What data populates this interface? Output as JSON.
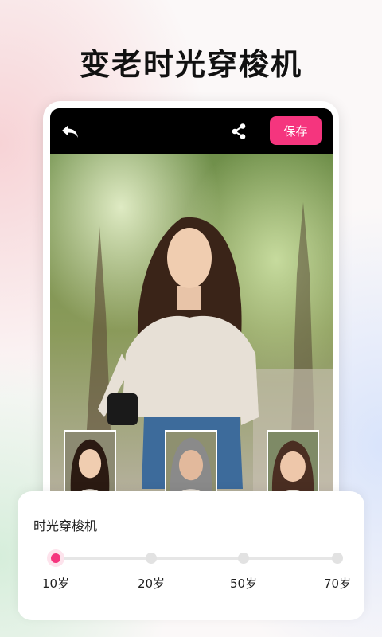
{
  "header": {
    "title": "变老时光穿梭机"
  },
  "editor": {
    "back_icon": "back-arrow-icon",
    "share_icon": "share-icon",
    "save_label": "保存",
    "accent_color": "#f5357e"
  },
  "thumbnails": [
    {
      "name": "young-face"
    },
    {
      "name": "old-face"
    },
    {
      "name": "middle-age-face"
    }
  ],
  "slider_panel": {
    "title": "时光穿梭机",
    "options": [
      "10岁",
      "20岁",
      "50岁",
      "70岁"
    ],
    "selected": "10岁"
  }
}
